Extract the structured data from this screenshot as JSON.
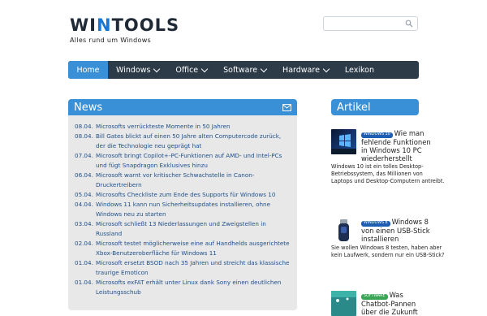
{
  "header": {
    "logo_prefix": "WI",
    "logo_accent": "N",
    "logo_suffix": "TOOLS",
    "tagline": "Alles rund um Windows",
    "search_placeholder": ""
  },
  "nav": [
    {
      "label": "Home",
      "active": true,
      "dropdown": false
    },
    {
      "label": "Windows",
      "active": false,
      "dropdown": true
    },
    {
      "label": "Office",
      "active": false,
      "dropdown": true
    },
    {
      "label": "Software",
      "active": false,
      "dropdown": true
    },
    {
      "label": "Hardware",
      "active": false,
      "dropdown": true
    },
    {
      "label": "Lexikon",
      "active": false,
      "dropdown": false
    }
  ],
  "news": {
    "title": "News",
    "items": [
      {
        "date": "08.04.",
        "title": "Microsofts verrückteste Momente in 50 Jahren"
      },
      {
        "date": "08.04.",
        "title": "Bill Gates blickt auf einen 50 Jahre alten Computercode zurück, der die Technologie neu geprägt hat"
      },
      {
        "date": "07.04.",
        "title": "Microsoft bringt Copilot+-PC-Funktionen auf AMD- und Intel-PCs und fügt Snapdragon Exklusives hinzu"
      },
      {
        "date": "06.04.",
        "title": "Microsoft warnt vor kritischer Schwachstelle in Canon-Druckertreibern"
      },
      {
        "date": "05.04.",
        "title": "Microsofts Checkliste zum Ende des Supports für Windows 10"
      },
      {
        "date": "04.04.",
        "title": "Windows 11 kann nun Sicherheitsupdates installieren, ohne Windows neu zu starten"
      },
      {
        "date": "03.04.",
        "title": "Microsoft schließt 13 Niederlassungen und Zweigstellen in Russland"
      },
      {
        "date": "02.04.",
        "title": "Microsoft testet möglicherweise eine auf Handhelds ausgerichtete Xbox-Benutzeroberfläche für Windows 11"
      },
      {
        "date": "01.04.",
        "title": "Microsoft ersetzt BSOD nach 35 Jahren und streicht das klassische traurige Emoticon"
      },
      {
        "date": "01.04.",
        "title": "Microsofts exFAT erhält unter Linux dank Sony einen deutlichen Leistungsschub"
      }
    ]
  },
  "articles": {
    "title": "Artikel",
    "items": [
      {
        "badge": "WINDOWS 10",
        "badge_color": "#1e5fb4",
        "title": "Wie man fehlende Funktionen in Windows 10 PC wiederherstellt",
        "description": "Windows 10 ist ein tolles Desktop-Betriebssystem, das Millionen von Laptops und Desktop-Computern antreibt."
      },
      {
        "badge": "WINDOWS 8",
        "badge_color": "#1e5fb4",
        "title": "Windows 8 von einen USB-Stick installieren",
        "description": "Sie wollen Windows 8 testen, haben aber kein Laufwerk, sondern nur ein USB-Stick?"
      },
      {
        "badge": "SOFTWARE",
        "badge_color": "#3aa655",
        "title": "Was Chatbot-Pannen über die Zukunft",
        "description": ""
      }
    ]
  }
}
